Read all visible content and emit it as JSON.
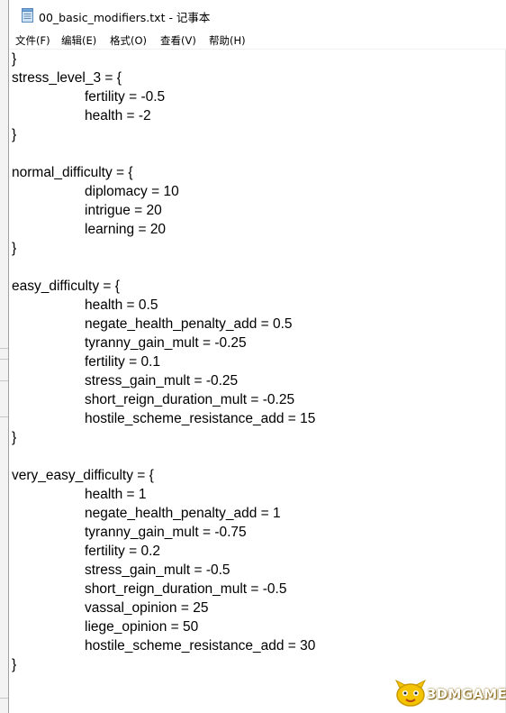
{
  "window": {
    "title": "00_basic_modifiers.txt - 记事本",
    "icon": "notepad-icon"
  },
  "menu": [
    {
      "label": "文件(F)"
    },
    {
      "label": "编辑(E)"
    },
    {
      "label": "格式(O)"
    },
    {
      "label": "查看(V)"
    },
    {
      "label": "帮助(H)"
    }
  ],
  "document": {
    "lines": [
      {
        "text": "}",
        "indent": false
      },
      {
        "text": "stress_level_3 = {",
        "indent": false
      },
      {
        "text": "fertility = -0.5",
        "indent": true
      },
      {
        "text": "health = -2",
        "indent": true
      },
      {
        "text": "}",
        "indent": false
      },
      {
        "text": "",
        "indent": false
      },
      {
        "text": "normal_difficulty = {",
        "indent": false
      },
      {
        "text": "diplomacy = 10",
        "indent": true
      },
      {
        "text": "intrigue = 20",
        "indent": true
      },
      {
        "text": "learning = 20",
        "indent": true
      },
      {
        "text": "}",
        "indent": false
      },
      {
        "text": "",
        "indent": false
      },
      {
        "text": "easy_difficulty = {",
        "indent": false
      },
      {
        "text": "health = 0.5",
        "indent": true
      },
      {
        "text": "negate_health_penalty_add = 0.5",
        "indent": true
      },
      {
        "text": "tyranny_gain_mult = -0.25",
        "indent": true
      },
      {
        "text": "fertility = 0.1",
        "indent": true
      },
      {
        "text": "stress_gain_mult = -0.25",
        "indent": true
      },
      {
        "text": "short_reign_duration_mult = -0.25",
        "indent": true
      },
      {
        "text": "hostile_scheme_resistance_add = 15",
        "indent": true
      },
      {
        "text": "}",
        "indent": false
      },
      {
        "text": "",
        "indent": false
      },
      {
        "text": "very_easy_difficulty = {",
        "indent": false
      },
      {
        "text": "health = 1",
        "indent": true
      },
      {
        "text": "negate_health_penalty_add = 1",
        "indent": true
      },
      {
        "text": "tyranny_gain_mult = -0.75",
        "indent": true
      },
      {
        "text": "fertility = 0.2",
        "indent": true
      },
      {
        "text": "stress_gain_mult = -0.5",
        "indent": true
      },
      {
        "text": "short_reign_duration_mult = -0.5",
        "indent": true
      },
      {
        "text": "vassal_opinion = 25",
        "indent": true
      },
      {
        "text": "liege_opinion = 50",
        "indent": true
      },
      {
        "text": "hostile_scheme_resistance_add = 30",
        "indent": true
      },
      {
        "text": "}",
        "indent": false
      }
    ]
  },
  "watermark": {
    "text": "3DMGAME",
    "icon": "3dmgame-logo-icon",
    "colors": {
      "mascot": "#f5c400",
      "text_outline": "#7a5a00"
    }
  }
}
